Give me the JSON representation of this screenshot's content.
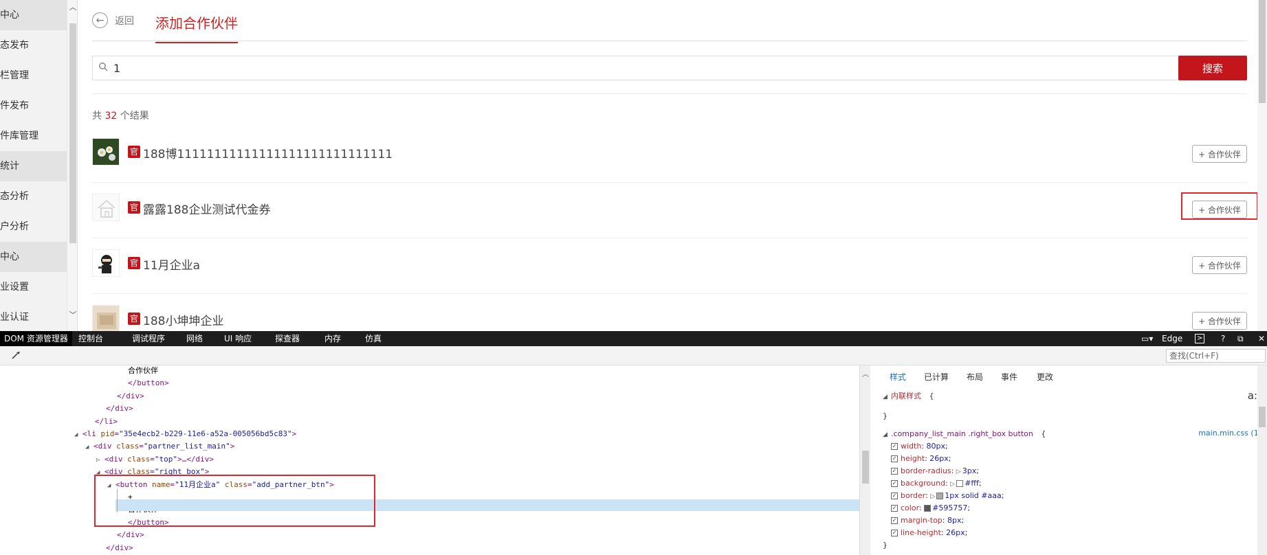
{
  "sidebar": {
    "items": [
      {
        "label": "中心",
        "dark": true
      },
      {
        "label": "态发布",
        "dark": false
      },
      {
        "label": "栏管理",
        "dark": false
      },
      {
        "label": "件发布",
        "dark": false
      },
      {
        "label": "件库管理",
        "dark": false
      },
      {
        "label": "统计",
        "dark": true
      },
      {
        "label": "态分析",
        "dark": false
      },
      {
        "label": "户分析",
        "dark": false
      },
      {
        "label": "中心",
        "dark": true
      },
      {
        "label": "业设置",
        "dark": false
      },
      {
        "label": "业认证",
        "dark": false
      }
    ]
  },
  "header": {
    "back_label": "返回",
    "title": "添加合作伙伴"
  },
  "search": {
    "value": "1",
    "button_label": "搜索"
  },
  "results": {
    "prefix": "共",
    "count": "32",
    "suffix": "个结果",
    "items": [
      {
        "badge": "官",
        "name": "188博11111111111111111111111111111",
        "button": "+ 合作伙伴"
      },
      {
        "badge": "官",
        "name": "露露188企业测试代金券",
        "button": "+ 合作伙伴"
      },
      {
        "badge": "官",
        "name": "11月企业a",
        "button": "+ 合作伙伴"
      },
      {
        "badge": "官",
        "name": "188小坤坤企业",
        "button": "+ 合作伙伴"
      }
    ]
  },
  "devtools": {
    "tabs": [
      "DOM 资源管理器",
      "控制台",
      "调试程序",
      "网络",
      "UI 响应",
      "探查器",
      "内存",
      "仿真"
    ],
    "browser": "Edge",
    "find_placeholder": "查找(Ctrl+F)",
    "help": "?",
    "dom_lines": [
      {
        "indent": 0,
        "parts": [
          [
            "tx",
            "合作伙伴"
          ]
        ]
      },
      {
        "indent": 0,
        "parts": [
          [
            "tg",
            "</button>"
          ]
        ]
      },
      {
        "indent": -1,
        "parts": [
          [
            "tg",
            "</div>"
          ]
        ]
      },
      {
        "indent": -2,
        "parts": [
          [
            "tg",
            "</div>"
          ]
        ]
      },
      {
        "indent": -3,
        "parts": [
          [
            "tg",
            "</li>"
          ]
        ]
      },
      {
        "indent": -4,
        "tri": "◢",
        "parts": [
          [
            "tg",
            "<li "
          ],
          [
            "an",
            "pid"
          ],
          [
            "tg",
            "="
          ],
          [
            "av",
            "\"35e4ecb2-b229-11e6-a52a-005056bd5c83\""
          ],
          [
            "tg",
            ">"
          ]
        ]
      },
      {
        "indent": -3,
        "tri": "◢",
        "parts": [
          [
            "tg",
            "<div "
          ],
          [
            "an",
            "class"
          ],
          [
            "tg",
            "="
          ],
          [
            "av",
            "\"partner_list_main\""
          ],
          [
            "tg",
            ">"
          ]
        ]
      },
      {
        "indent": -2,
        "tri": "▷",
        "parts": [
          [
            "tg",
            "<div "
          ],
          [
            "an",
            "class"
          ],
          [
            "tg",
            "="
          ],
          [
            "av",
            "\"top\""
          ],
          [
            "tg",
            ">…</div>"
          ]
        ]
      },
      {
        "indent": -2,
        "tri": "◢",
        "parts": [
          [
            "tg",
            "<div "
          ],
          [
            "an",
            "class"
          ],
          [
            "tg",
            "="
          ],
          [
            "av",
            "\"right_box\""
          ],
          [
            "tg",
            ">"
          ]
        ]
      },
      {
        "indent": -1,
        "tri": "◢",
        "parts": [
          [
            "tg",
            "<button "
          ],
          [
            "an",
            "name"
          ],
          [
            "tg",
            "="
          ],
          [
            "av",
            "\"11月企业a\""
          ],
          [
            "tg",
            " "
          ],
          [
            "an",
            "class"
          ],
          [
            "tg",
            "="
          ],
          [
            "av",
            "\"add_partner_btn\""
          ],
          [
            "tg",
            ">"
          ]
        ]
      },
      {
        "indent": 0,
        "parts": [
          [
            "tx",
            "+"
          ]
        ]
      },
      {
        "indent": 0,
        "parts": [
          [
            "tx",
            "合作伙伴"
          ]
        ]
      },
      {
        "indent": 0,
        "parts": [
          [
            "tg",
            "</button>"
          ]
        ]
      },
      {
        "indent": -1,
        "parts": [
          [
            "tg",
            "</div>"
          ]
        ]
      },
      {
        "indent": -2,
        "parts": [
          [
            "tg",
            "</div>"
          ]
        ]
      },
      {
        "indent": -3,
        "parts": [
          [
            "tg",
            "</li>"
          ]
        ]
      }
    ],
    "styles": {
      "tabs": [
        "样式",
        "已计算",
        "布局",
        "事件",
        "更改"
      ],
      "inline_label": "内联样式",
      "inline_open": "{",
      "close_brace": "}",
      "aa": "a:",
      "selector": ".company_list_main .right_box button",
      "source": "main.min.css (1)",
      "props": [
        {
          "name": "width",
          "value": "80px;"
        },
        {
          "name": "height",
          "value": "26px;"
        },
        {
          "name": "border-radius",
          "value": "3px;",
          "arrow": true
        },
        {
          "name": "background",
          "value": "#fff;",
          "arrow": true,
          "swatch": "#ffffff"
        },
        {
          "name": "border",
          "value": "1px solid #aaa;",
          "arrow": true,
          "swatch": "#aaaaaa"
        },
        {
          "name": "color",
          "value": "#595757;",
          "swatch": "#595757"
        },
        {
          "name": "margin-top",
          "value": "8px;"
        },
        {
          "name": "line-height",
          "value": "26px;"
        }
      ]
    }
  },
  "colors": {
    "accent": "#c3161c",
    "highlight": "#e3262b",
    "dom_select": "#cce2f5"
  }
}
